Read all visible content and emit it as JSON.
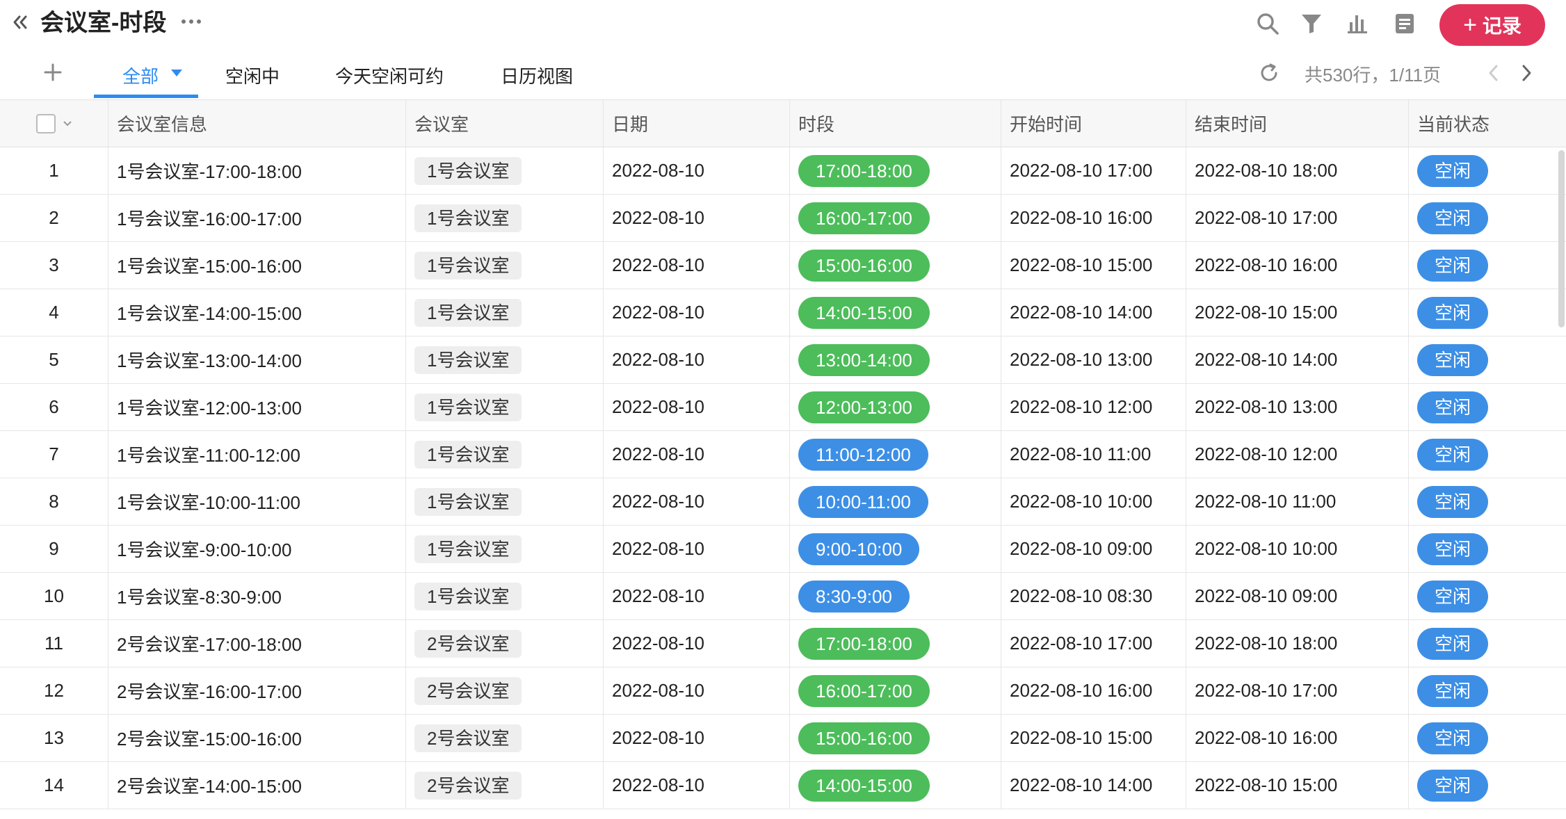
{
  "header": {
    "title": "会议室-时段",
    "record_button_label": "记录",
    "icons": [
      "double-chevron-left-icon",
      "more-dots-icon",
      "search-icon",
      "filter-icon",
      "bar-chart-icon",
      "document-icon",
      "plus-icon"
    ]
  },
  "tabs": [
    {
      "label": "全部",
      "active": true
    },
    {
      "label": "空闲中",
      "active": false
    },
    {
      "label": "今天空闲可约",
      "active": false
    },
    {
      "label": "日历视图",
      "active": false
    }
  ],
  "pagination": {
    "summary": "共530行，1/11页"
  },
  "colors": {
    "accent": "#2d8cf0",
    "record_button": "#e2345a",
    "slot_green": "#4cbd5a",
    "slot_blue": "#3d8fe6",
    "status_blue": "#3d8fe6"
  },
  "table": {
    "columns": [
      "会议室信息",
      "会议室",
      "日期",
      "时段",
      "开始时间",
      "结束时间",
      "当前状态"
    ],
    "rows": [
      {
        "index": "1",
        "info": "1号会议室-17:00-18:00",
        "room": "1号会议室",
        "date": "2022-08-10",
        "slot": "17:00-18:00",
        "slot_color": "green",
        "start": "2022-08-10 17:00",
        "end": "2022-08-10 18:00",
        "status": "空闲"
      },
      {
        "index": "2",
        "info": "1号会议室-16:00-17:00",
        "room": "1号会议室",
        "date": "2022-08-10",
        "slot": "16:00-17:00",
        "slot_color": "green",
        "start": "2022-08-10 16:00",
        "end": "2022-08-10 17:00",
        "status": "空闲"
      },
      {
        "index": "3",
        "info": "1号会议室-15:00-16:00",
        "room": "1号会议室",
        "date": "2022-08-10",
        "slot": "15:00-16:00",
        "slot_color": "green",
        "start": "2022-08-10 15:00",
        "end": "2022-08-10 16:00",
        "status": "空闲"
      },
      {
        "index": "4",
        "info": "1号会议室-14:00-15:00",
        "room": "1号会议室",
        "date": "2022-08-10",
        "slot": "14:00-15:00",
        "slot_color": "green",
        "start": "2022-08-10 14:00",
        "end": "2022-08-10 15:00",
        "status": "空闲"
      },
      {
        "index": "5",
        "info": "1号会议室-13:00-14:00",
        "room": "1号会议室",
        "date": "2022-08-10",
        "slot": "13:00-14:00",
        "slot_color": "green",
        "start": "2022-08-10 13:00",
        "end": "2022-08-10 14:00",
        "status": "空闲"
      },
      {
        "index": "6",
        "info": "1号会议室-12:00-13:00",
        "room": "1号会议室",
        "date": "2022-08-10",
        "slot": "12:00-13:00",
        "slot_color": "green",
        "start": "2022-08-10 12:00",
        "end": "2022-08-10 13:00",
        "status": "空闲"
      },
      {
        "index": "7",
        "info": "1号会议室-11:00-12:00",
        "room": "1号会议室",
        "date": "2022-08-10",
        "slot": "11:00-12:00",
        "slot_color": "blue",
        "start": "2022-08-10 11:00",
        "end": "2022-08-10 12:00",
        "status": "空闲"
      },
      {
        "index": "8",
        "info": "1号会议室-10:00-11:00",
        "room": "1号会议室",
        "date": "2022-08-10",
        "slot": "10:00-11:00",
        "slot_color": "blue",
        "start": "2022-08-10 10:00",
        "end": "2022-08-10 11:00",
        "status": "空闲"
      },
      {
        "index": "9",
        "info": "1号会议室-9:00-10:00",
        "room": "1号会议室",
        "date": "2022-08-10",
        "slot": "9:00-10:00",
        "slot_color": "blue",
        "start": "2022-08-10 09:00",
        "end": "2022-08-10 10:00",
        "status": "空闲"
      },
      {
        "index": "10",
        "info": "1号会议室-8:30-9:00",
        "room": "1号会议室",
        "date": "2022-08-10",
        "slot": "8:30-9:00",
        "slot_color": "blue",
        "start": "2022-08-10 08:30",
        "end": "2022-08-10 09:00",
        "status": "空闲"
      },
      {
        "index": "11",
        "info": "2号会议室-17:00-18:00",
        "room": "2号会议室",
        "date": "2022-08-10",
        "slot": "17:00-18:00",
        "slot_color": "green",
        "start": "2022-08-10 17:00",
        "end": "2022-08-10 18:00",
        "status": "空闲"
      },
      {
        "index": "12",
        "info": "2号会议室-16:00-17:00",
        "room": "2号会议室",
        "date": "2022-08-10",
        "slot": "16:00-17:00",
        "slot_color": "green",
        "start": "2022-08-10 16:00",
        "end": "2022-08-10 17:00",
        "status": "空闲"
      },
      {
        "index": "13",
        "info": "2号会议室-15:00-16:00",
        "room": "2号会议室",
        "date": "2022-08-10",
        "slot": "15:00-16:00",
        "slot_color": "green",
        "start": "2022-08-10 15:00",
        "end": "2022-08-10 16:00",
        "status": "空闲"
      },
      {
        "index": "14",
        "info": "2号会议室-14:00-15:00",
        "room": "2号会议室",
        "date": "2022-08-10",
        "slot": "14:00-15:00",
        "slot_color": "green",
        "start": "2022-08-10 14:00",
        "end": "2022-08-10 15:00",
        "status": "空闲"
      }
    ]
  }
}
